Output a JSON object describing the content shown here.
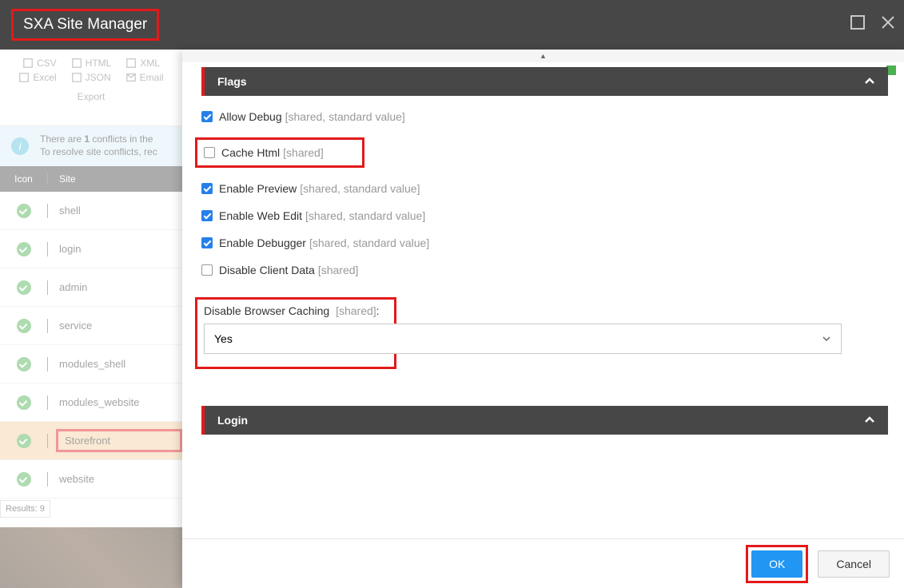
{
  "app": {
    "title": "SXA Site Manager"
  },
  "export": {
    "csv": "CSV",
    "html": "HTML",
    "xml": "XML",
    "excel": "Excel",
    "json": "JSON",
    "email": "Email",
    "label": "Export"
  },
  "conflict": {
    "line1_a": "There are ",
    "line1_b": "1",
    "line1_c": " conflicts in the",
    "line2": "To resolve site conflicts, rec"
  },
  "grid": {
    "head_icon": "Icon",
    "head_site": "Site",
    "rows": [
      {
        "name": "shell"
      },
      {
        "name": "login"
      },
      {
        "name": "admin"
      },
      {
        "name": "service"
      },
      {
        "name": "modules_shell"
      },
      {
        "name": "modules_website"
      },
      {
        "name": "Storefront"
      },
      {
        "name": "website"
      }
    ],
    "results": "Results: 9"
  },
  "sections": {
    "flags": "Flags",
    "login": "Login"
  },
  "flags": {
    "allow_debug": {
      "label": "Allow Debug",
      "hint": "[shared, standard value]",
      "checked": true
    },
    "cache_html": {
      "label": "Cache Html",
      "hint": "[shared]",
      "checked": false
    },
    "enable_preview": {
      "label": "Enable Preview",
      "hint": "[shared, standard value]",
      "checked": true
    },
    "enable_web_edit": {
      "label": "Enable Web Edit",
      "hint": "[shared, standard value]",
      "checked": true
    },
    "enable_debugger": {
      "label": "Enable Debugger",
      "hint": "[shared, standard value]",
      "checked": true
    },
    "disable_client_data": {
      "label": "Disable Client Data",
      "hint": "[shared]",
      "checked": false
    },
    "disable_browser_caching": {
      "label": "Disable Browser Caching",
      "hint": "[shared]",
      "value": "Yes"
    }
  },
  "footer": {
    "ok": "OK",
    "cancel": "Cancel"
  }
}
